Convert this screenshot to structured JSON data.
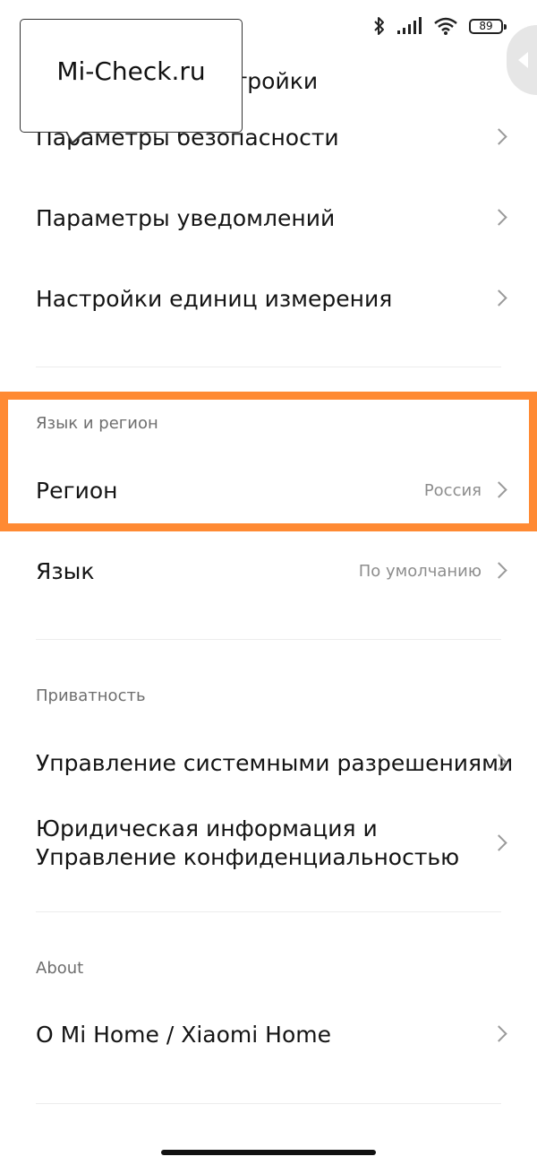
{
  "status_bar": {
    "battery_level": "89",
    "icons": [
      "bluetooth-icon",
      "signal-icon",
      "wifi-icon",
      "battery-icon"
    ]
  },
  "watermark": {
    "text": "Mi-Check.ru"
  },
  "partial_heading": "стройки",
  "items": {
    "security": {
      "label": "Параметры безопасности"
    },
    "notifications": {
      "label": "Параметры уведомлений"
    },
    "units": {
      "label": "Настройки единиц измерения"
    }
  },
  "language_region": {
    "title": "Язык и регион",
    "region": {
      "label": "Регион",
      "value": "Россия"
    },
    "language": {
      "label": "Язык",
      "value": "По умолчанию"
    }
  },
  "privacy": {
    "title": "Приватность",
    "permissions": {
      "label": "Управление системными разрешениями"
    },
    "legal": {
      "line1": "Юридическая информация и",
      "line2": "Управление конфиденциальностью"
    }
  },
  "about": {
    "title": "About",
    "app": {
      "label": "О Mi Home / Xiaomi Home"
    }
  },
  "colors": {
    "highlight": "#ff8a33",
    "text": "#141414",
    "secondary": "#8d8d8d"
  }
}
